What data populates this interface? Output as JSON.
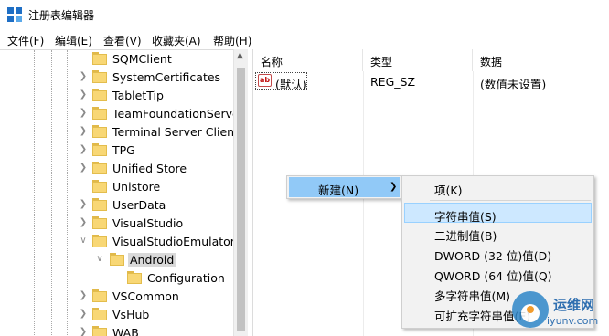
{
  "window": {
    "title": "注册表编辑器"
  },
  "menubar": [
    {
      "label": "文件(F)"
    },
    {
      "label": "编辑(E)"
    },
    {
      "label": "查看(V)"
    },
    {
      "label": "收藏夹(A)"
    },
    {
      "label": "帮助(H)"
    }
  ],
  "tree": [
    {
      "label": "SQMClient",
      "twisty": "none"
    },
    {
      "label": "SystemCertificates",
      "twisty": "collapsed"
    },
    {
      "label": "TabletTip",
      "twisty": "collapsed"
    },
    {
      "label": "TeamFoundationServe",
      "twisty": "collapsed"
    },
    {
      "label": "Terminal Server Client",
      "twisty": "collapsed"
    },
    {
      "label": "TPG",
      "twisty": "collapsed"
    },
    {
      "label": "Unified Store",
      "twisty": "collapsed"
    },
    {
      "label": "Unistore",
      "twisty": "none"
    },
    {
      "label": "UserData",
      "twisty": "collapsed"
    },
    {
      "label": "VisualStudio",
      "twisty": "collapsed"
    },
    {
      "label": "VisualStudioEmulator",
      "twisty": "expanded"
    },
    {
      "label": "Android",
      "twisty": "expanded",
      "selected": true
    },
    {
      "label": "Configuration",
      "twisty": "none"
    },
    {
      "label": "VSCommon",
      "twisty": "collapsed"
    },
    {
      "label": "VsHub",
      "twisty": "collapsed"
    },
    {
      "label": "WAB",
      "twisty": "collapsed"
    }
  ],
  "list": {
    "headers": {
      "name": "名称",
      "type": "类型",
      "data": "数据"
    },
    "rows": [
      {
        "icon": "ab",
        "name": "(默认)",
        "type": "REG_SZ",
        "data": "(数值未设置)"
      }
    ]
  },
  "context_menu": {
    "new_label": "新建(N)"
  },
  "submenu": {
    "items": [
      {
        "label": "项(K)"
      },
      {
        "label": "字符串值(S)"
      },
      {
        "label": "二进制值(B)"
      },
      {
        "label": "DWORD (32 位)值(D)"
      },
      {
        "label": "QWORD (64 位)值(Q)"
      },
      {
        "label": "多字符串值(M)"
      },
      {
        "label": "可扩充字符串值(E)"
      }
    ]
  },
  "watermark": {
    "line1": "运维网",
    "line2": "iyunv.com"
  },
  "colors": {
    "folder": "#f8d775",
    "menu_highlight": "#91c9f7",
    "submenu_highlight": "#cde8ff",
    "app_icon": "#1f6fc5"
  }
}
